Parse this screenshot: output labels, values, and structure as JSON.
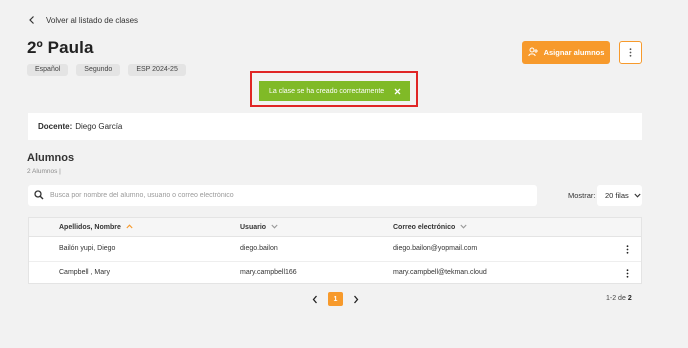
{
  "back_link": {
    "label": "Volver al listado de clases"
  },
  "class_title": "2º Paula",
  "tags": [
    "Español",
    "Segundo",
    "ESP 2024-25"
  ],
  "actions": {
    "assign_label": "Asignar alumnos"
  },
  "toast": {
    "message": "La clase se ha creado correctamente"
  },
  "teacher": {
    "label": "Docente:",
    "name": "Diego García"
  },
  "students": {
    "title": "Alumnos",
    "count": "2 Alumnos |"
  },
  "search": {
    "placeholder": "Busca por nombre del alumno, usuario o correo electrónico",
    "value": ""
  },
  "per_page": {
    "label": "Mostrar:",
    "selected": "20 filas"
  },
  "table": {
    "columns": [
      "Apellidos, Nombre",
      "Usuario",
      "Correo electrónico"
    ],
    "rows": [
      {
        "name": "Bailón yupi, Diego",
        "user": "diego.bailon",
        "email": "diego.bailon@yopmail.com"
      },
      {
        "name": "Campbell , Mary",
        "user": "mary.campbell166",
        "email": "mary.campbell@tekman.cloud"
      }
    ]
  },
  "pagination": {
    "current": "1",
    "range_prefix": "1-2 de",
    "total": "2"
  },
  "colors": {
    "accent": "#f79a2c",
    "toast": "#80ba27",
    "highlight": "#e02626"
  }
}
